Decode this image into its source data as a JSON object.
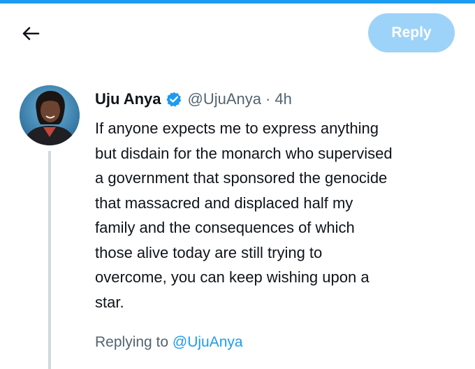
{
  "header": {
    "back_icon": "arrow-left-icon",
    "reply_label": "Reply",
    "reply_color": "#9dd3f8",
    "accent_color": "#1d9bf0"
  },
  "tweet": {
    "display_name": "Uju Anya",
    "verified_icon": "verified-badge-icon",
    "handle": "@UjuAnya",
    "separator": "·",
    "time": "4h",
    "body_lines": [
      "If anyone expects me to express anything",
      "but disdain for the monarch who supervised",
      "a government that sponsored the genocide",
      "that massacred and displaced half my",
      "family and the consequences of which",
      "those alive today are still trying to",
      "overcome, you can keep wishing upon a",
      "star."
    ]
  },
  "replying": {
    "prefix": "Replying to",
    "handle": "@UjuAnya"
  }
}
